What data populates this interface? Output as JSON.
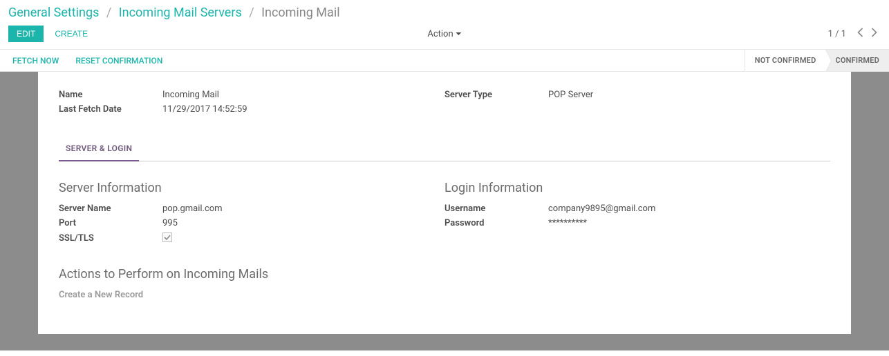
{
  "breadcrumb": {
    "level1": "General Settings",
    "level2": "Incoming Mail Servers",
    "current": "Incoming Mail"
  },
  "buttons": {
    "edit": "EDIT",
    "create": "CREATE",
    "action": "Action",
    "fetch_now": "FETCH NOW",
    "reset_confirmation": "RESET CONFIRMATION"
  },
  "pager": {
    "text": "1 / 1"
  },
  "status": {
    "not_confirmed": "NOT CONFIRMED",
    "confirmed": "CONFIRMED"
  },
  "labels": {
    "name": "Name",
    "last_fetch_date": "Last Fetch Date",
    "server_type": "Server Type",
    "server_name": "Server Name",
    "port": "Port",
    "ssl_tls": "SSL/TLS",
    "username": "Username",
    "password": "Password"
  },
  "values": {
    "name": "Incoming Mail",
    "last_fetch_date": "11/29/2017 14:52:59",
    "server_type": "POP Server",
    "server_name": "pop.gmail.com",
    "port": "995",
    "ssl_tls_checked": true,
    "username": "company9895@gmail.com",
    "password": "**********"
  },
  "tabs": {
    "server_login": "SERVER & LOGIN"
  },
  "sections": {
    "server_info": "Server Information",
    "login_info": "Login Information",
    "actions_incoming": "Actions to Perform on Incoming Mails",
    "create_new_record": "Create a New Record"
  }
}
